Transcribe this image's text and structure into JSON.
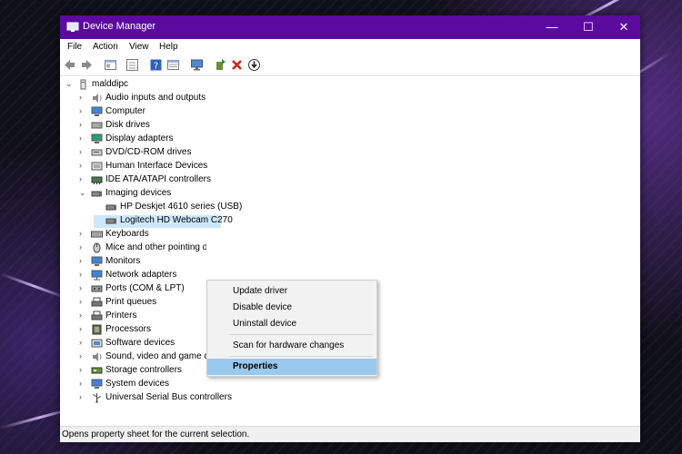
{
  "window": {
    "title": "Device Manager",
    "controls": {
      "minimize": "—",
      "maximize": "☐",
      "close": "✕"
    }
  },
  "menu": [
    "File",
    "Action",
    "View",
    "Help"
  ],
  "toolbar_icons": [
    "back-icon",
    "forward-icon",
    "properties-pane-icon",
    "console-tree-icon",
    "help-icon",
    "device-list-icon",
    "monitor-icon",
    "update-driver-icon",
    "uninstall-icon",
    "download-icon"
  ],
  "tree": {
    "root": "malddipc",
    "categories": [
      "Audio inputs and outputs",
      "Computer",
      "Disk drives",
      "Display adapters",
      "DVD/CD-ROM drives",
      "Human Interface Devices",
      "IDE ATA/ATAPI controllers",
      "Imaging devices",
      "Keyboards",
      "Mice and other pointing devices",
      "Monitors",
      "Network adapters",
      "Ports (COM & LPT)",
      "Print queues",
      "Printers",
      "Processors",
      "Software devices",
      "Sound, video and game controllers",
      "Storage controllers",
      "System devices",
      "Universal Serial Bus controllers"
    ],
    "imaging_children": [
      "HP Deskjet 4610 series (USB)",
      "Logitech HD Webcam C270"
    ],
    "chevrons": {
      "collapsed": "›",
      "expanded": "⌄"
    }
  },
  "context_menu": {
    "items": [
      "Update driver",
      "Disable device",
      "Uninstall device",
      "Scan for hardware changes",
      "Properties"
    ],
    "highlighted": "Properties"
  },
  "status_bar": {
    "text": "Opens property sheet for the current selection."
  },
  "colors": {
    "titlebar": "#5b0aa0",
    "selection": "#cce8ff",
    "menu_highlight": "#99c9ef"
  }
}
